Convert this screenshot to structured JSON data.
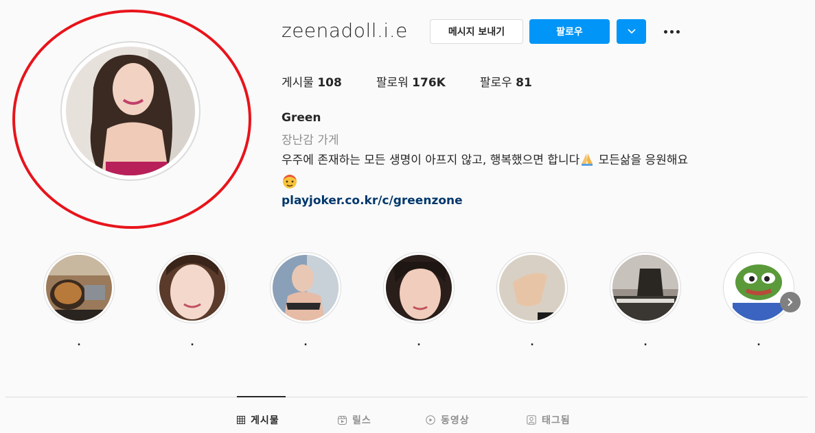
{
  "profile": {
    "username": "zeenadoll.i.e",
    "message_button": "메시지 보내기",
    "follow_button": "팔로우",
    "full_name": "Green",
    "category": "장난감 가게",
    "bio_line1": "우주에 존재하는 모든 생명이 아프지 않고, 행복했으면 합니다",
    "bio_line1_after": " 모든삶을 응원해요",
    "link": "playjoker.co.kr/c/greenzone"
  },
  "stats": [
    {
      "label": "게시물",
      "value": "108"
    },
    {
      "label": "팔로워",
      "value": "176K"
    },
    {
      "label": "팔로우",
      "value": "81"
    }
  ],
  "highlights": [
    {
      "label": "."
    },
    {
      "label": "."
    },
    {
      "label": "."
    },
    {
      "label": "."
    },
    {
      "label": "."
    },
    {
      "label": "."
    },
    {
      "label": "."
    }
  ],
  "tabs": [
    {
      "label": "게시물",
      "icon": "grid-icon",
      "active": true
    },
    {
      "label": "릴스",
      "icon": "reels-icon",
      "active": false
    },
    {
      "label": "동영상",
      "icon": "play-icon",
      "active": false
    },
    {
      "label": "태그됨",
      "icon": "tagged-icon",
      "active": false
    }
  ],
  "colors": {
    "accent": "#0095f6",
    "annotation": "#e8141b",
    "link": "#00376b"
  }
}
